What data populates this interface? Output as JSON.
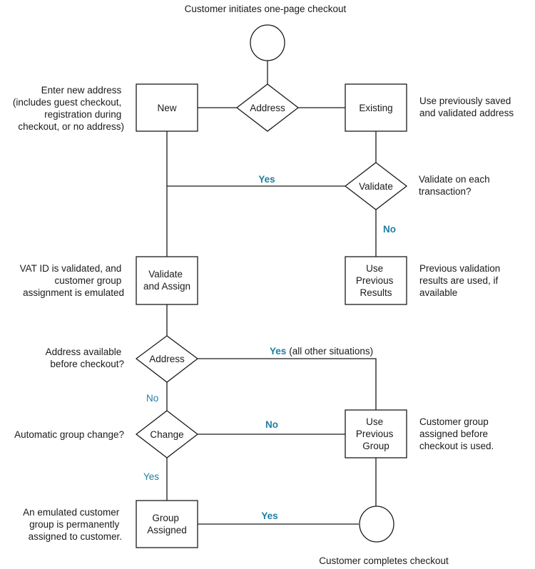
{
  "diagram": {
    "start_caption": "Customer initiates one-page checkout",
    "end_caption": "Customer completes checkout",
    "nodes": {
      "address_decision": "Address",
      "new": "New",
      "existing": "Existing",
      "validate_decision": "Validate",
      "validate_assign": [
        "Validate",
        "and Assign"
      ],
      "use_previous_results": [
        "Use",
        "Previous",
        "Results"
      ],
      "address_decision_2": "Address",
      "change_decision": "Change",
      "use_previous_group": [
        "Use",
        "Previous",
        "Group"
      ],
      "group_assigned": [
        "Group",
        "Assigned"
      ]
    },
    "annotations": {
      "new": [
        "Enter new address",
        "(includes guest checkout,",
        "registration during",
        "checkout, or no address)"
      ],
      "existing": [
        "Use previously saved",
        "and validated address"
      ],
      "validate": [
        "Validate on each",
        "transaction?"
      ],
      "validate_assign": [
        "VAT ID is validated, and",
        "customer group",
        "assignment is emulated"
      ],
      "use_previous_results": [
        "Previous validation",
        "results are used, if",
        "available"
      ],
      "address_2": [
        "Address available",
        "before checkout?"
      ],
      "change": [
        "Automatic group change?"
      ],
      "use_previous_group": [
        "Customer group",
        "assigned before",
        "checkout is used."
      ],
      "group_assigned": [
        "An emulated customer",
        "group is permanently",
        "assigned to customer."
      ]
    },
    "edge_labels": {
      "validate_yes": "Yes",
      "validate_no": "No",
      "address2_yes": "Yes",
      "address2_yes_note": "(all other situations)",
      "address2_no": "No",
      "change_no": "No",
      "change_yes": "Yes",
      "group_assigned_yes": "Yes"
    },
    "colors": {
      "label": "#1f7ea1",
      "stroke": "#1a1a1a"
    }
  }
}
